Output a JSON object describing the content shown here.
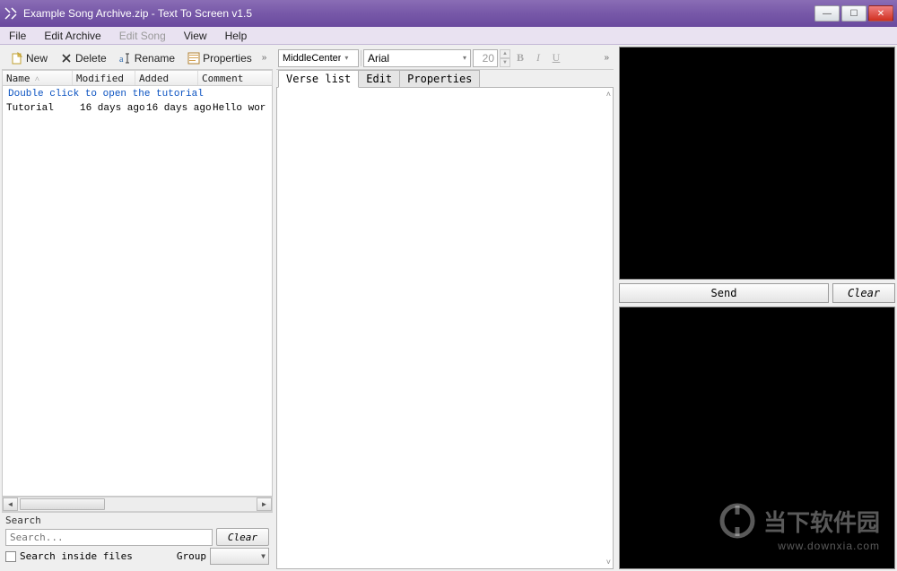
{
  "window": {
    "title": "Example Song Archive.zip - Text To Screen v1.5"
  },
  "menu": {
    "file": "File",
    "edit_archive": "Edit Archive",
    "edit_song": "Edit Song",
    "view": "View",
    "help": "Help"
  },
  "left_toolbar": {
    "new": "New",
    "delete": "Delete",
    "rename": "Rename",
    "properties": "Properties"
  },
  "columns": {
    "name": "Name",
    "modified": "Modified",
    "added": "Added",
    "comment": "Comment"
  },
  "list": {
    "group": "Double click to open the tutorial",
    "rows": [
      {
        "name": "Tutorial",
        "modified": "16 days ago",
        "added": "16 days ago",
        "comment": "Hello wor"
      }
    ]
  },
  "search": {
    "heading": "Search",
    "placeholder": "Search...",
    "clear": "Clear",
    "inside": "Search inside files",
    "group_label": "Group"
  },
  "mid_toolbar": {
    "align": "MiddleCenter",
    "font": "Arial",
    "size": "20",
    "bold": "B",
    "italic": "I",
    "underline": "U"
  },
  "tabs": {
    "verse": "Verse list",
    "edit": "Edit",
    "props": "Properties"
  },
  "right": {
    "send": "Send",
    "clear": "Clear"
  },
  "watermark": {
    "text": "当下软件园",
    "url": "www.downxia.com"
  }
}
